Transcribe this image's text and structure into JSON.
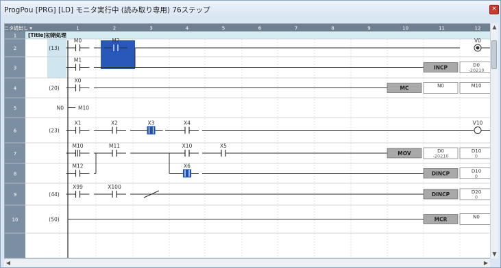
{
  "window": {
    "title": "ProgPou [PRG] [LD] モニタ実行中 (読み取り専用) 76ステップ",
    "close_glyph": "×"
  },
  "colors": {
    "header_bg": "#6f7f90",
    "row_header_bg": "#7c8ea2",
    "step_col_bg": "#cfe6f0",
    "line": "#2b2b2b",
    "selection": "#1e4fb7",
    "fb_box": "#a9a9a9"
  },
  "grid": {
    "header_left": "モニタ読出し ▾",
    "columns": [
      "1",
      "2",
      "3",
      "4",
      "5",
      "6",
      "7",
      "8",
      "9",
      "10",
      "11",
      "12"
    ],
    "row_numbers": [
      "1",
      "2",
      "3",
      "4",
      "5",
      "6",
      "7",
      "8",
      "9",
      "10"
    ],
    "comment_row1": "[Title]初期処理",
    "steps": {
      "r2": "(13)",
      "r4": "(20)",
      "r6": "(23)",
      "r9": "(44)",
      "r10": "(50)"
    }
  },
  "contacts": [
    {
      "id": "M0",
      "label": "M0"
    },
    {
      "id": "M2",
      "label": "M2"
    },
    {
      "id": "M1",
      "label": "M1"
    },
    {
      "id": "X0",
      "label": "X0"
    },
    {
      "id": "X1",
      "label": "X1"
    },
    {
      "id": "X2",
      "label": "X2"
    },
    {
      "id": "X3",
      "label": "X3"
    },
    {
      "id": "X4",
      "label": "X4"
    },
    {
      "id": "M10",
      "label": "M10"
    },
    {
      "id": "M11",
      "label": "M11"
    },
    {
      "id": "X10",
      "label": "X10"
    },
    {
      "id": "X5",
      "label": "X5"
    },
    {
      "id": "M12",
      "label": "M12"
    },
    {
      "id": "X6",
      "label": "X6"
    },
    {
      "id": "X99",
      "label": "X99"
    },
    {
      "id": "X100",
      "label": "X100"
    }
  ],
  "coils": [
    {
      "id": "V0",
      "label": "V0"
    },
    {
      "id": "V10",
      "label": "V10"
    }
  ],
  "instructions": {
    "incp": {
      "name": "INCP",
      "operand": "D0",
      "value": "-20210"
    },
    "mc": {
      "name": "MC",
      "arg1": "N0",
      "arg2": "M10"
    },
    "mov": {
      "name": "MOV",
      "arg1": "D0",
      "arg1_value": "-20210",
      "arg2": "D10",
      "arg2_value": "0"
    },
    "dincp1": {
      "name": "DINCP",
      "operand": "D10",
      "value": "0"
    },
    "dincp2": {
      "name": "DINCP",
      "operand": "D20",
      "value": "0"
    },
    "mcr": {
      "name": "MCR",
      "operand": "N0"
    }
  },
  "mc_bus": {
    "n": "N0",
    "m": "M10"
  }
}
